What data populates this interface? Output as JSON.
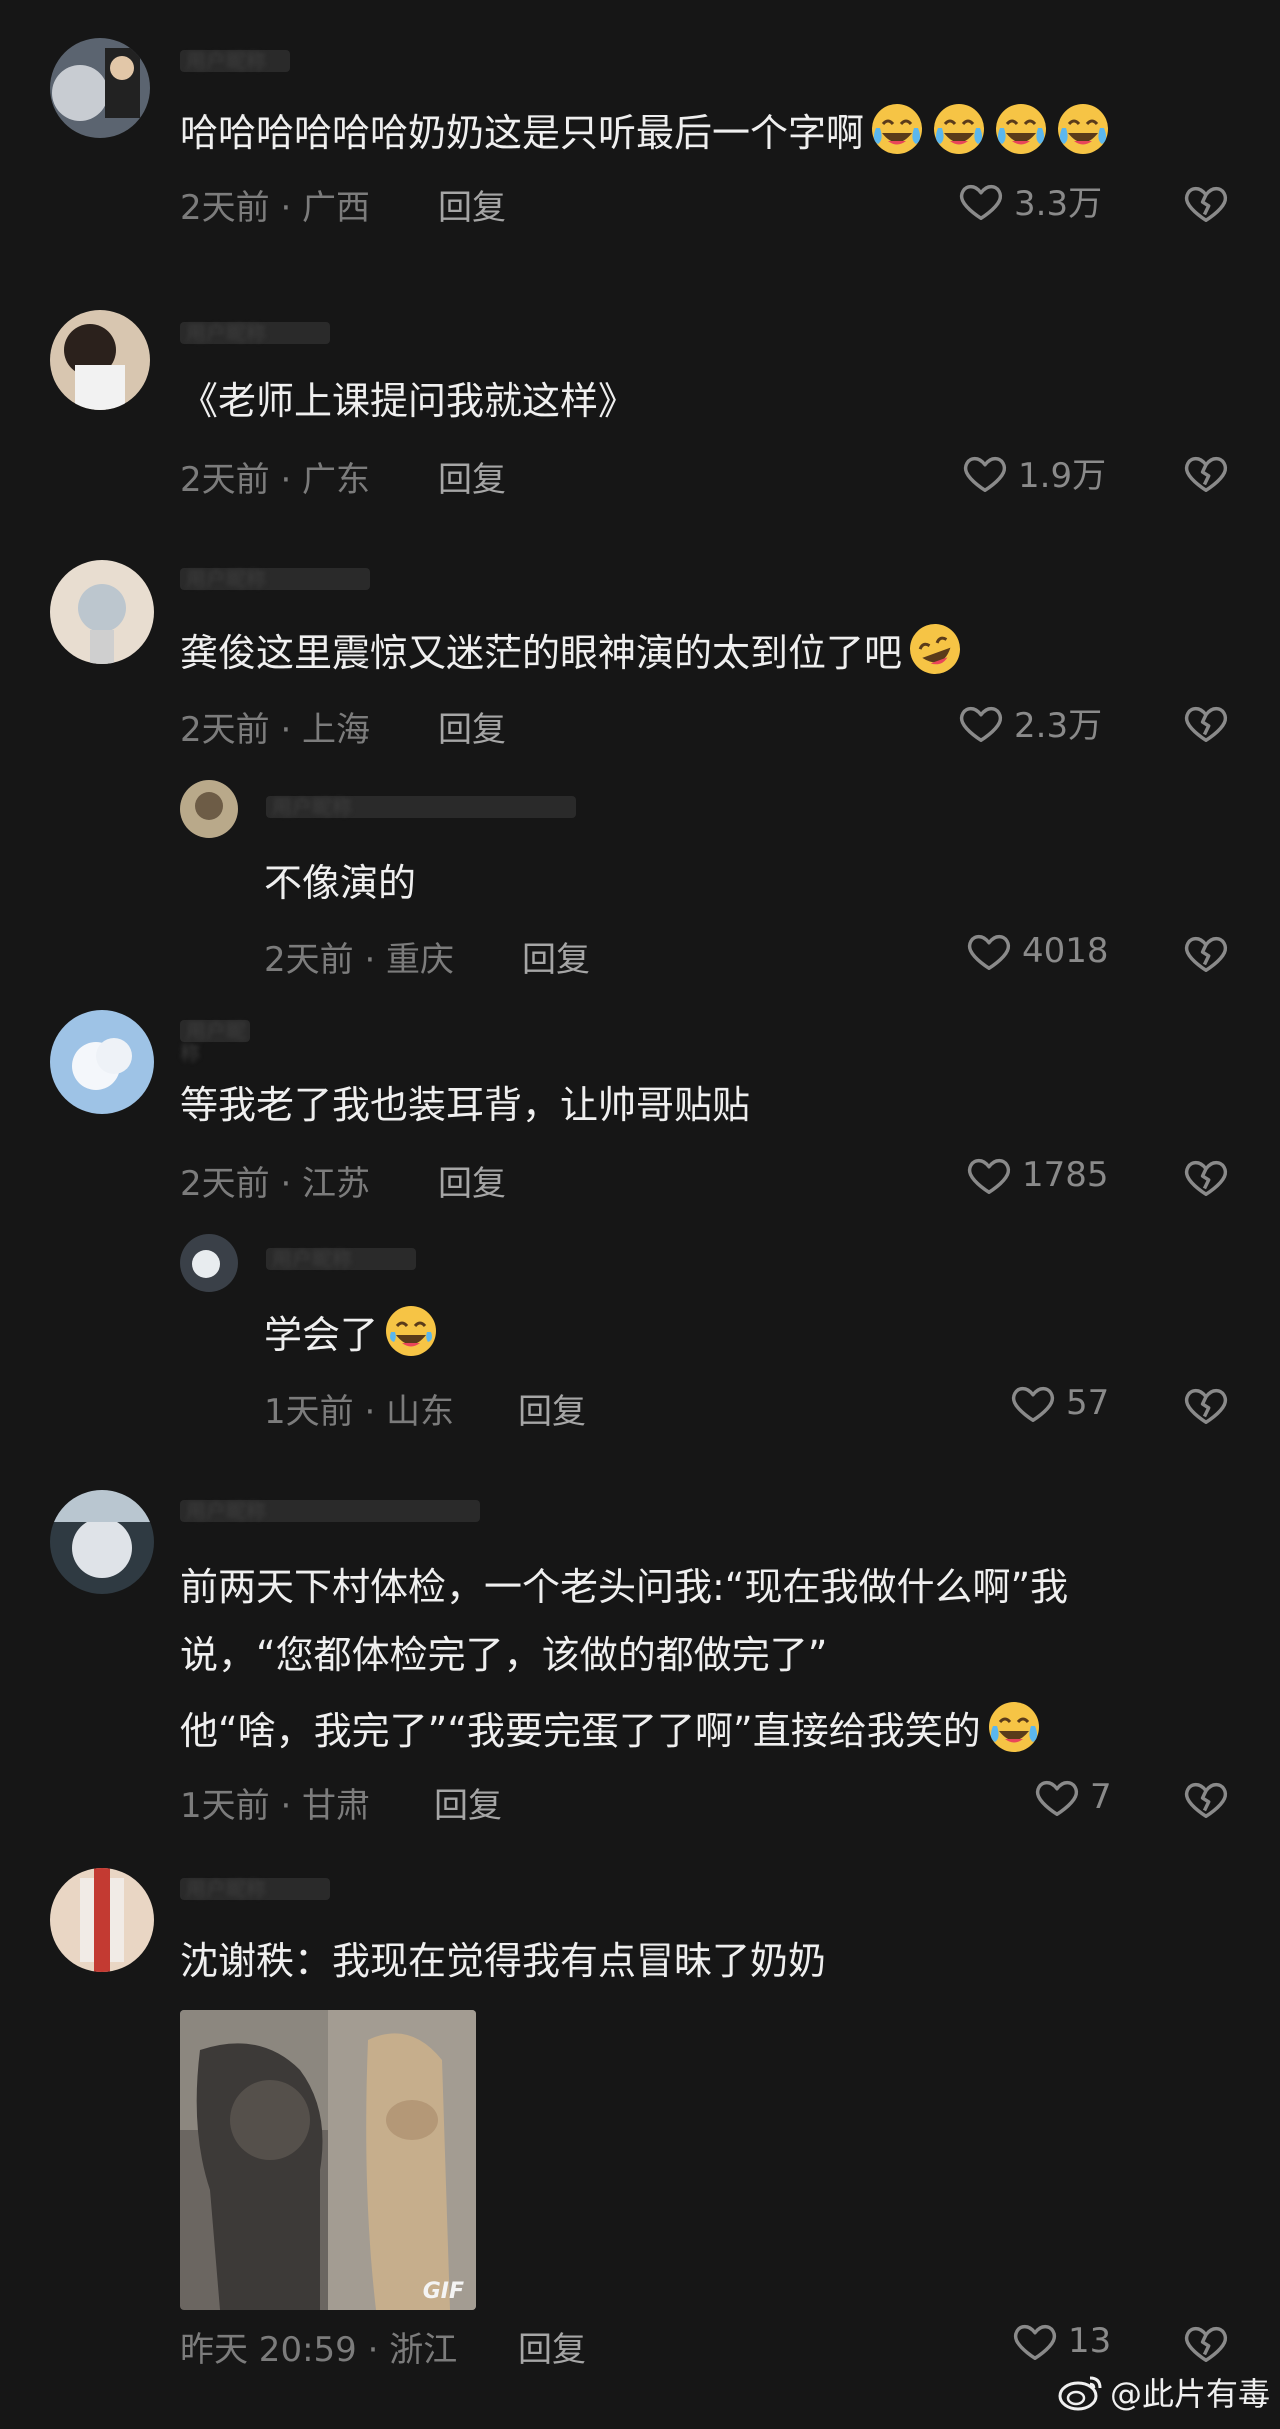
{
  "comments": [
    {
      "user": "用户昵称",
      "text": "哈哈哈哈哈哈奶奶这是只听最后一个字啊",
      "emoji_count": 4,
      "emoji": "crying-laugh-emoji",
      "time_loc": "2天前 · 广西",
      "reply": "回复",
      "likes": "3.3万"
    },
    {
      "user": "用户昵称",
      "text": "《老师上课提问我就这样》",
      "time_loc": "2天前 · 广东",
      "reply": "回复",
      "likes": "1.9万"
    },
    {
      "user": "用户昵称",
      "text": "龚俊这里震惊又迷茫的眼神演的太到位了吧",
      "emoji": "rofl-emoji",
      "time_loc": "2天前 · 上海",
      "reply": "回复",
      "likes": "2.3万"
    },
    {
      "user": "用户昵称",
      "text": "不像演的",
      "time_loc": "2天前 · 重庆",
      "reply": "回复",
      "likes": "4018"
    },
    {
      "user": "用户昵称",
      "text": "等我老了我也装耳背，让帅哥贴贴",
      "time_loc": "2天前 · 江苏",
      "reply": "回复",
      "likes": "1785"
    },
    {
      "user": "用户昵称",
      "text": "学会了",
      "emoji": "joy-emoji",
      "time_loc": "1天前 · 山东",
      "reply": "回复",
      "likes": "57"
    },
    {
      "user": "用户昵称",
      "lines": [
        "前两天下村体检，一个老头问我:“现在我做什么啊”我",
        "说，“您都体检完了，该做的都做完了”",
        "他“啥，我完了”“我要完蛋了了啊”直接给我笑的"
      ],
      "emoji": "crying-laugh-emoji",
      "time_loc": "1天前 · 甘肃",
      "reply": "回复",
      "likes": "7"
    },
    {
      "user": "用户昵称",
      "text": "沈谢秩：我现在觉得我有点冒昧了奶奶",
      "gif_label": "GIF",
      "time_loc": "昨天 20:59 · 浙江",
      "reply": "回复",
      "likes": "13"
    }
  ],
  "watermark": {
    "text": "@此片有毒",
    "icon": "weibo-logo-icon"
  },
  "colors": {
    "background": "#161616",
    "text": "#efefef",
    "meta": "#7c7c7c",
    "icon": "#8a8a8a"
  }
}
